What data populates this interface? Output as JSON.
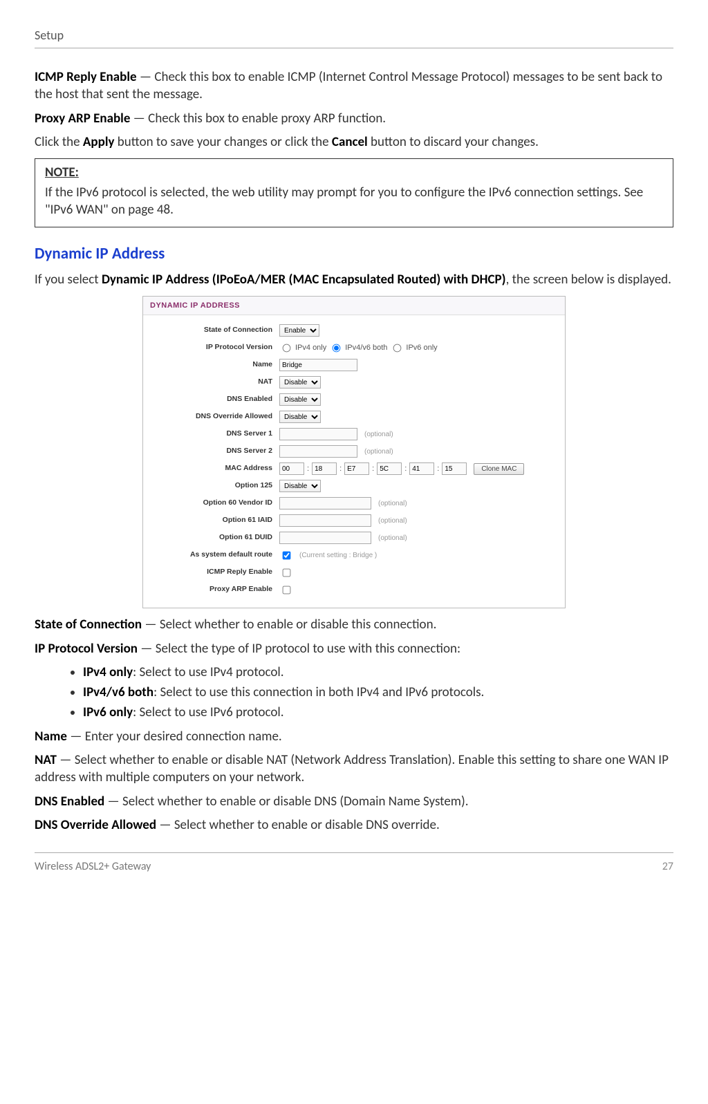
{
  "header": {
    "title": "Setup"
  },
  "para1": {
    "term": "ICMP Reply Enable",
    "text": " — Check this box to enable ICMP (Internet Control Message Protocol) messages to be sent back to the host that sent the message."
  },
  "para2": {
    "term": "Proxy ARP Enable",
    "text": " — Check this box to enable proxy ARP function."
  },
  "para3": {
    "pre": "Click the ",
    "b1": "Apply",
    "mid": " button to save your changes or click the ",
    "b2": "Cancel",
    "post": " button to discard your changes."
  },
  "note": {
    "label": "NOTE:",
    "text": "If the IPv6 protocol is selected, the web utility may prompt for you to configure the IPv6 connection settings. See \"IPv6 WAN\" on page 48."
  },
  "section_heading": "Dynamic IP Address",
  "intro": {
    "pre": "If you select ",
    "bold": "Dynamic IP Address (IPoEoA/MER (MAC Encapsulated Routed) with DHCP)",
    "post": ", the screen below is displayed."
  },
  "ui": {
    "panel_title": "DYNAMIC IP ADDRESS",
    "labels": {
      "state": "State of Connection",
      "ipver": "IP Protocol Version",
      "name": "Name",
      "nat": "NAT",
      "dns_en": "DNS Enabled",
      "dns_ov": "DNS Override Allowed",
      "dns1": "DNS Server 1",
      "dns2": "DNS Server 2",
      "mac": "MAC Address",
      "o125": "Option 125",
      "o60": "Option 60 Vendor ID",
      "o61a": "Option 61 IAID",
      "o61b": "Option 61 DUID",
      "defrt": "As system default route",
      "icmp": "ICMP Reply Enable",
      "proxy": "Proxy ARP Enable"
    },
    "values": {
      "state": "Enable",
      "name": "Bridge",
      "nat": "Disable",
      "dns_en": "Disable",
      "dns_ov": "Disable",
      "o125": "Disable",
      "mac": [
        "00",
        "18",
        "E7",
        "5C",
        "41",
        "15"
      ],
      "defrt_hint": "(Current setting : Bridge )"
    },
    "radio": {
      "ipv4": "IPv4 only",
      "both": "IPv4/v6 both",
      "ipv6": "IPv6 only"
    },
    "hint_optional": "(optional)",
    "btn_clone": "Clone MAC"
  },
  "desc": {
    "state": {
      "term": "State of Connection",
      "text": " — Select whether to enable or disable this connection."
    },
    "ipver": {
      "term": "IP Protocol Version",
      "text": " — Select the type of IP protocol to use with this connection:"
    },
    "bullets": [
      {
        "term": "IPv4 only",
        "text": ": Select to use IPv4 protocol."
      },
      {
        "term": "IPv4/v6 both",
        "text": ": Select to use this connection in both IPv4 and IPv6 protocols."
      },
      {
        "term": "IPv6 only",
        "text": ": Select to use IPv6 protocol."
      }
    ],
    "name": {
      "term": "Name",
      "text": " — Enter your desired connection name."
    },
    "nat": {
      "term": "NAT",
      "text": " — Select whether to enable or disable NAT (Network Address Translation). Enable this setting to share one WAN IP address with multiple computers on your network."
    },
    "dns_en": {
      "term": "DNS Enabled",
      "text": " — Select whether to enable or disable DNS (Domain Name System)."
    },
    "dns_ov": {
      "term": "DNS Override Allowed",
      "text": " — Select whether to enable or disable DNS override."
    }
  },
  "footer": {
    "left": "Wireless ADSL2+ Gateway",
    "right": "27"
  }
}
